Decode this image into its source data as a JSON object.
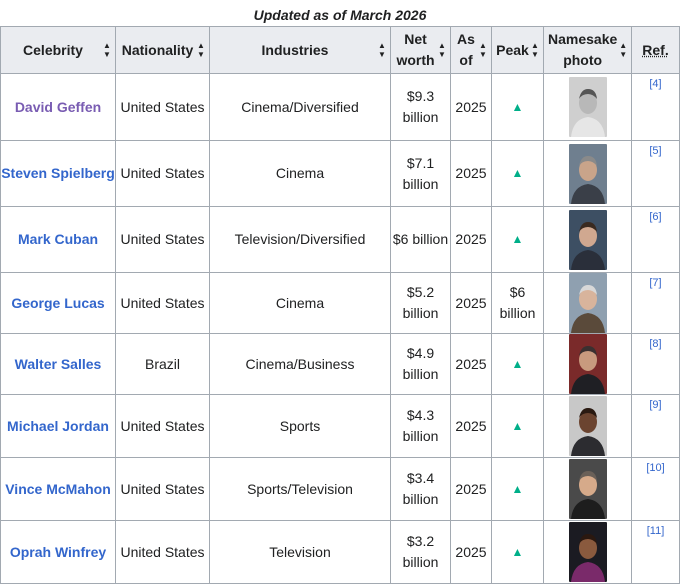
{
  "caption": "Updated as of March 2026",
  "headers": {
    "celebrity": "Celebrity",
    "nationality": "Nationality",
    "industries": "Industries",
    "net_worth": "Net worth",
    "as_of": "As of",
    "peak": "Peak",
    "photo": "Namesake photo",
    "ref": "Ref."
  },
  "rows": [
    {
      "name": "David Geffen",
      "nationality": "United States",
      "industries": "Cinema/Diversified",
      "net_worth": "$9.3 billion",
      "as_of": "2025",
      "peak": "▲",
      "ref": "[4]"
    },
    {
      "name": "Steven Spielberg",
      "nationality": "United States",
      "industries": "Cinema",
      "net_worth": "$7.1 billion",
      "as_of": "2025",
      "peak": "▲",
      "ref": "[5]"
    },
    {
      "name": "Mark Cuban",
      "nationality": "United States",
      "industries": "Television/Diversified",
      "net_worth": "$6 billion",
      "as_of": "2025",
      "peak": "▲",
      "ref": "[6]"
    },
    {
      "name": "George Lucas",
      "nationality": "United States",
      "industries": "Cinema",
      "net_worth": "$5.2 billion",
      "as_of": "2025",
      "peak": "$6 billion",
      "ref": "[7]"
    },
    {
      "name": "Walter Salles",
      "nationality": "Brazil",
      "industries": "Cinema/Business",
      "net_worth": "$4.9 billion",
      "as_of": "2025",
      "peak": "▲",
      "ref": "[8]"
    },
    {
      "name": "Michael Jordan",
      "nationality": "United States",
      "industries": "Sports",
      "net_worth": "$4.3 billion",
      "as_of": "2025",
      "peak": "▲",
      "ref": "[9]"
    },
    {
      "name": "Vince McMahon",
      "nationality": "United States",
      "industries": "Sports/Television",
      "net_worth": "$3.4 billion",
      "as_of": "2025",
      "peak": "▲",
      "ref": "[10]"
    },
    {
      "name": "Oprah Winfrey",
      "nationality": "United States",
      "industries": "Television",
      "net_worth": "$3.2 billion",
      "as_of": "2025",
      "peak": "▲",
      "ref": "[11]"
    }
  ],
  "colors": {
    "link": "#3366cc",
    "visited_link": "#795cb2",
    "increase_arrow": "#00af89",
    "header_bg": "#eaecf0",
    "border": "#a2a9b1"
  },
  "icons": {
    "sort": "sort-arrows-icon",
    "increase": "increase-arrow-icon"
  }
}
